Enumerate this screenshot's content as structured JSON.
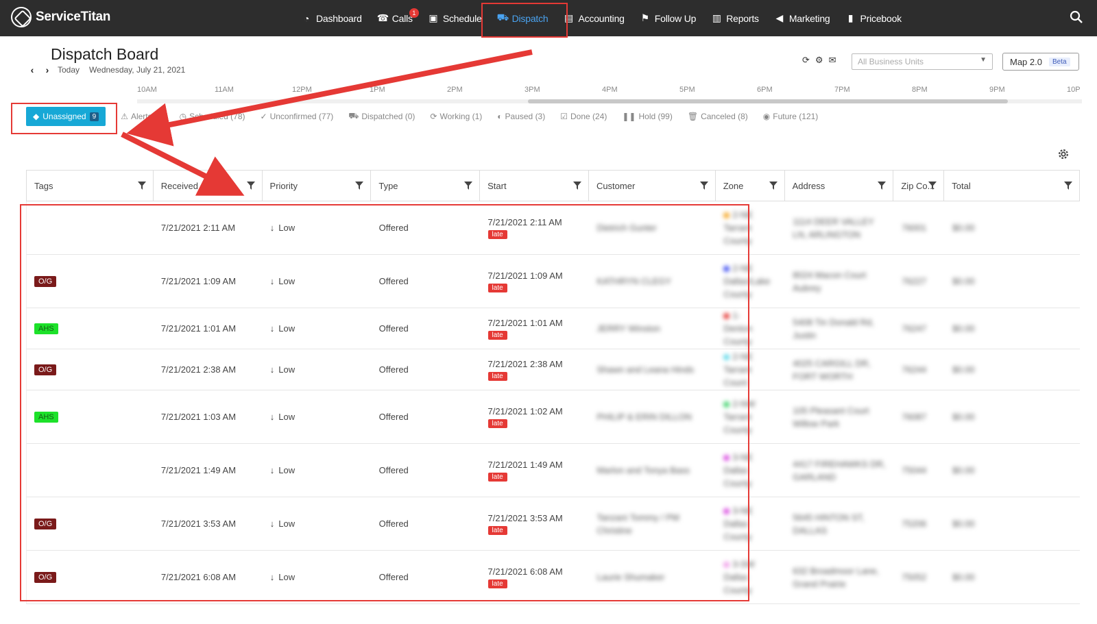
{
  "brand": {
    "name": "ServiceTitan"
  },
  "nav": {
    "items": [
      {
        "id": "dashboard",
        "label": "Dashboard",
        "icon": "dashboard-icon"
      },
      {
        "id": "calls",
        "label": "Calls",
        "icon": "phone-icon",
        "badge": "1"
      },
      {
        "id": "schedule",
        "label": "Schedule",
        "icon": "calendar-icon"
      },
      {
        "id": "dispatch",
        "label": "Dispatch",
        "icon": "truck-icon",
        "active": true
      },
      {
        "id": "accounting",
        "label": "Accounting",
        "icon": "document-icon"
      },
      {
        "id": "follow-up",
        "label": "Follow Up",
        "icon": "flag-icon"
      },
      {
        "id": "reports",
        "label": "Reports",
        "icon": "bar-chart-icon"
      },
      {
        "id": "marketing",
        "label": "Marketing",
        "icon": "megaphone-icon"
      },
      {
        "id": "pricebook",
        "label": "Pricebook",
        "icon": "book-icon"
      }
    ]
  },
  "header": {
    "title": "Dispatch Board",
    "today_label": "Today",
    "date": "Wednesday, July 21, 2021",
    "business_units_placeholder": "All Business Units",
    "map_button": "Map 2.0",
    "beta_label": "Beta"
  },
  "timeline": {
    "hours": [
      "10AM",
      "11AM",
      "12PM",
      "1PM",
      "2PM",
      "3PM",
      "4PM",
      "5PM",
      "6PM",
      "7PM",
      "8PM",
      "9PM",
      "10P"
    ]
  },
  "status_tabs": [
    {
      "label": "Unassigned",
      "count": "9",
      "active": true,
      "icon": "tag-icon"
    },
    {
      "label": "Alerts (9)",
      "icon": "warning-icon"
    },
    {
      "label": "Scheduled (78)",
      "icon": "clock-icon"
    },
    {
      "label": "Unconfirmed (77)",
      "icon": "check-circle-icon"
    },
    {
      "label": "Dispatched (0)",
      "icon": "truck-icon"
    },
    {
      "label": "Working (1)",
      "icon": "refresh-icon"
    },
    {
      "label": "Paused (3)",
      "icon": "pause-icon"
    },
    {
      "label": "Done (24)",
      "icon": "checkbox-icon"
    },
    {
      "label": "Hold (99)",
      "icon": "hold-icon"
    },
    {
      "label": "Canceled (8)",
      "icon": "trash-icon"
    },
    {
      "label": "Future (121)",
      "icon": "eye-icon"
    }
  ],
  "table": {
    "columns": [
      "Tags",
      "Received",
      "Priority",
      "Type",
      "Start",
      "Customer",
      "Zone",
      "Address",
      "Zip Co...",
      "Total"
    ],
    "rows": [
      {
        "tag": "",
        "received": "7/21/2021 2:11 AM",
        "priority": "Low",
        "type": "Offered",
        "start": "7/21/2021 2:11 AM",
        "late": "late",
        "customer": "Dietrich Gunter",
        "zone_color": "#f5a623",
        "zone": "2-NE Tarrant County",
        "address": "1114 DEER VALLEY LN, ARLINGTON",
        "zip": "76001",
        "total": "$0.00"
      },
      {
        "tag": "O/G",
        "tag_type": "og",
        "received": "7/21/2021 1:09 AM",
        "priority": "Low",
        "type": "Offered",
        "start": "7/21/2021 1:09 AM",
        "late": "late",
        "customer": "KATHRYN CLEGY",
        "zone_color": "#3d4cf0",
        "zone": "2-NE Dallas/Lake County",
        "address": "8024 Macon Court Aubrey",
        "zip": "76227",
        "total": "$0.00"
      },
      {
        "tag": "AHS",
        "tag_type": "ahs",
        "received": "7/21/2021 1:01 AM",
        "priority": "Low",
        "type": "Offered",
        "start": "7/21/2021 1:01 AM",
        "late": "late",
        "customer": "JERRY Winston",
        "zone_color": "#e53935",
        "zone": "1-Denton County",
        "address": "5408 Tin Donald Rd, Justin",
        "zip": "76247",
        "total": "$0.00"
      },
      {
        "tag": "O/G",
        "tag_type": "og",
        "received": "7/21/2021 2:38 AM",
        "priority": "Low",
        "type": "Offered",
        "start": "7/21/2021 2:38 AM",
        "late": "late",
        "customer": "Shawn and Leana Hinds",
        "zone_color": "#5fd8e8",
        "zone": "2-NE Tarrant Count",
        "address": "4025 CARGILL DR, FORT WORTH",
        "zip": "76244",
        "total": "$0.00"
      },
      {
        "tag": "AHS",
        "tag_type": "ahs",
        "received": "7/21/2021 1:03 AM",
        "priority": "Low",
        "type": "Offered",
        "start": "7/21/2021 1:02 AM",
        "late": "late",
        "customer": "PHILIP & ERIN DILLON",
        "zone_color": "#3ed36a",
        "zone": "2-NW Tarrant County",
        "address": "105 Pleasant Court Willow Park",
        "zip": "76087",
        "total": "$0.00"
      },
      {
        "tag": "",
        "received": "7/21/2021 1:49 AM",
        "priority": "Low",
        "type": "Offered",
        "start": "7/21/2021 1:49 AM",
        "late": "late",
        "customer": "Marlon and Tonya Bass",
        "zone_color": "#d94be0",
        "zone": "3-NE Dallas County",
        "address": "4417 FIREHAWKS DR, GARLAND",
        "zip": "75044",
        "total": "$0.00"
      },
      {
        "tag": "O/G",
        "tag_type": "og",
        "received": "7/21/2021 3:53 AM",
        "priority": "Low",
        "type": "Offered",
        "start": "7/21/2021 3:53 AM",
        "late": "late",
        "customer": "Tanzani Tommy / PM Christine",
        "zone_color": "#d94be0",
        "zone": "3-NE Dallas County",
        "address": "5645 HINTON ST, DALLAS",
        "zip": "75206",
        "total": "$0.00"
      },
      {
        "tag": "O/G",
        "tag_type": "og",
        "received": "7/21/2021 6:08 AM",
        "priority": "Low",
        "type": "Offered",
        "start": "7/21/2021 6:08 AM",
        "late": "late",
        "customer": "Laurie Shumaker",
        "zone_color": "#f09be8",
        "zone": "3-SW Dallas County",
        "address": "632 Broadmoor Lane, Grand Prairie",
        "zip": "75052",
        "total": "$0.00"
      }
    ]
  },
  "colors": {
    "topbar": "#2d2d2d",
    "active_nav": "#4aa3f0",
    "unassigned_tab": "#17a8d6",
    "late": "#e53935",
    "highlight": "#e53935"
  }
}
